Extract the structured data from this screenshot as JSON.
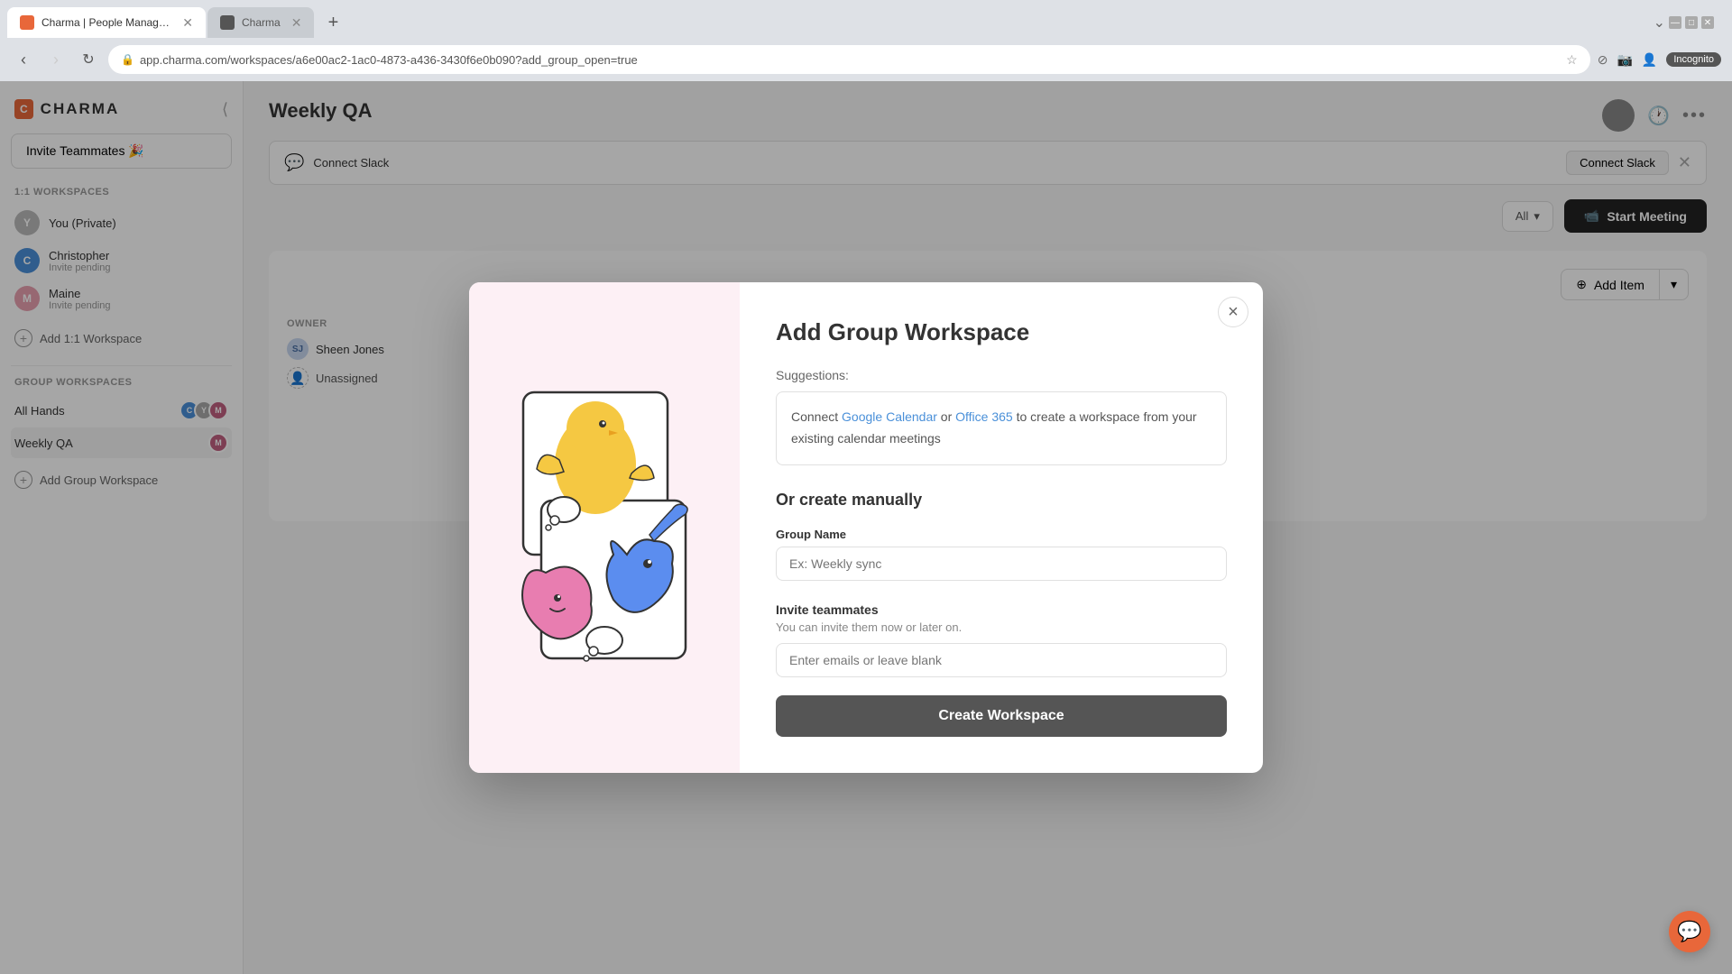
{
  "browser": {
    "tabs": [
      {
        "id": "tab1",
        "favicon_color": "#e8673a",
        "label": "Charma | People Management S...",
        "active": true
      },
      {
        "id": "tab2",
        "favicon_color": "#555",
        "label": "Charma",
        "active": false
      }
    ],
    "url": "app.charma.com/workspaces/a6e00ac2-1ac0-4873-a436-3430f6e0b090?add_group_open=true",
    "incognito_label": "Incognito"
  },
  "sidebar": {
    "logo_text": "CHARMA",
    "invite_button_label": "Invite Teammates 🎉",
    "one_on_one_section_label": "1:1 Workspaces",
    "users": [
      {
        "name": "You (Private)",
        "sub": "",
        "avatar_initials": "Y",
        "avatar_color": "#aaa"
      },
      {
        "name": "Christopher",
        "sub": "Invite pending",
        "avatar_initials": "C",
        "avatar_color": "#4a90d9"
      },
      {
        "name": "Maine",
        "sub": "Invite pending",
        "avatar_initials": "M",
        "avatar_color": "#e8a0b0"
      }
    ],
    "add_one_on_one_label": "Add 1:1 Workspace",
    "group_section_label": "Group Workspaces",
    "group_workspaces": [
      {
        "name": "All Hands",
        "avatars": [
          "C",
          "Y",
          "M"
        ],
        "avatar_colors": [
          "#4a90d9",
          "#aaa",
          "#c06080"
        ]
      },
      {
        "name": "Weekly QA",
        "avatars": [
          "M"
        ],
        "avatar_colors": [
          "#c06080"
        ]
      }
    ],
    "add_group_label": "Add Group Workspace"
  },
  "main": {
    "page_title": "Weekly QA",
    "connect_slack_label": "Connect Slack",
    "start_meeting_label": "Start Meeting",
    "add_item_label": "Add Item",
    "owner_section_label": "OWNER",
    "owner_name": "Sheen Jones",
    "unassigned_label": "Unassigned"
  },
  "modal": {
    "title": "Add Group Workspace",
    "close_label": "×",
    "suggestions_label": "Suggestions:",
    "suggestions_text_before": "Connect ",
    "suggestions_google_cal": "Google Calendar",
    "suggestions_or": " or ",
    "suggestions_office": "Office 365",
    "suggestions_text_after": " to create a workspace from your existing calendar meetings",
    "or_create_label": "Or create manually",
    "group_name_label": "Group Name",
    "group_name_placeholder": "Ex: Weekly sync",
    "invite_teammates_label": "Invite teammates",
    "invite_sub_label": "You can invite them now or later on.",
    "invite_placeholder": "Enter emails or leave blank",
    "create_button_label": "Create Workspace"
  }
}
